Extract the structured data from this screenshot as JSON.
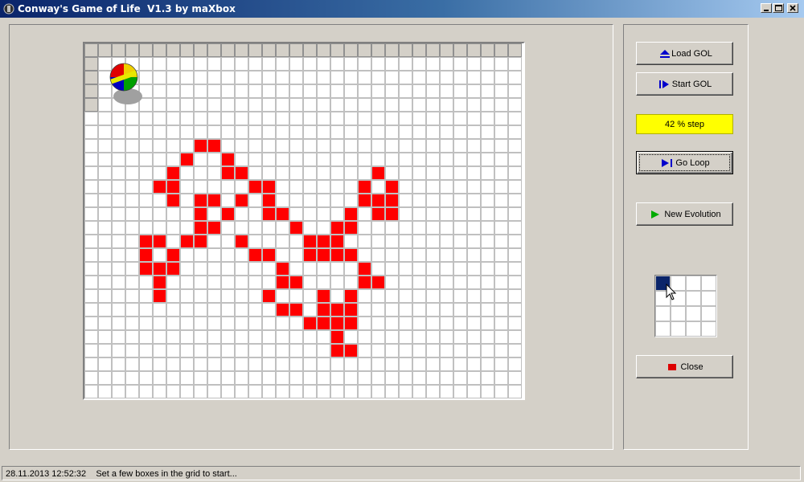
{
  "window": {
    "title": "Conway's Game of Life  V1.3 by maXbox",
    "controls": [
      "minimize",
      "maximize",
      "close"
    ]
  },
  "buttons": {
    "load": {
      "label": "Load GOL",
      "icon": "eject-icon",
      "icon_color": "#0000cc"
    },
    "start": {
      "label": "Start GOL",
      "icon": "play-bar-icon",
      "icon_color": "#0000cc"
    },
    "loop": {
      "label": "Go Loop",
      "icon": "play-bar-icon",
      "icon_color": "#0000cc"
    },
    "new_evolution": {
      "label": "New Evolution",
      "icon": "play-icon",
      "icon_color": "#00aa00"
    },
    "close": {
      "label": "Close",
      "icon": "stop-square-icon",
      "icon_color": "#dd0000"
    }
  },
  "progress": {
    "text": "42 % step",
    "background": "#ffff00"
  },
  "grid": {
    "cols": 32,
    "rows": 26,
    "alive_color": "#ff0000",
    "line_color": "#c0c0c0",
    "alive": [
      [
        8,
        7
      ],
      [
        9,
        7
      ],
      [
        7,
        8
      ],
      [
        10,
        8
      ],
      [
        6,
        9
      ],
      [
        10,
        9
      ],
      [
        11,
        9
      ],
      [
        5,
        10
      ],
      [
        6,
        10
      ],
      [
        12,
        10
      ],
      [
        13,
        10
      ],
      [
        6,
        11
      ],
      [
        8,
        11
      ],
      [
        9,
        11
      ],
      [
        11,
        11
      ],
      [
        13,
        11
      ],
      [
        8,
        12
      ],
      [
        10,
        12
      ],
      [
        13,
        12
      ],
      [
        14,
        12
      ],
      [
        8,
        13
      ],
      [
        9,
        13
      ],
      [
        15,
        13
      ],
      [
        4,
        14
      ],
      [
        5,
        14
      ],
      [
        7,
        14
      ],
      [
        8,
        14
      ],
      [
        11,
        14
      ],
      [
        4,
        15
      ],
      [
        6,
        15
      ],
      [
        12,
        15
      ],
      [
        13,
        15
      ],
      [
        4,
        16
      ],
      [
        5,
        16
      ],
      [
        6,
        16
      ],
      [
        14,
        16
      ],
      [
        5,
        17
      ],
      [
        14,
        17
      ],
      [
        15,
        17
      ],
      [
        5,
        18
      ],
      [
        13,
        18
      ],
      [
        14,
        19
      ],
      [
        15,
        19
      ],
      [
        16,
        20
      ],
      [
        17,
        20
      ],
      [
        21,
        9
      ],
      [
        20,
        10
      ],
      [
        22,
        10
      ],
      [
        20,
        11
      ],
      [
        21,
        11
      ],
      [
        22,
        11
      ],
      [
        19,
        12
      ],
      [
        21,
        12
      ],
      [
        22,
        12
      ],
      [
        18,
        13
      ],
      [
        19,
        13
      ],
      [
        16,
        14
      ],
      [
        17,
        14
      ],
      [
        18,
        14
      ],
      [
        16,
        15
      ],
      [
        17,
        15
      ],
      [
        18,
        15
      ],
      [
        19,
        15
      ],
      [
        20,
        16
      ],
      [
        20,
        17
      ],
      [
        21,
        17
      ],
      [
        17,
        18
      ],
      [
        19,
        18
      ],
      [
        17,
        19
      ],
      [
        18,
        19
      ],
      [
        19,
        19
      ],
      [
        18,
        20
      ],
      [
        19,
        20
      ],
      [
        18,
        21
      ],
      [
        18,
        22
      ],
      [
        19,
        22
      ]
    ]
  },
  "mini_grid": {
    "cols": 4,
    "rows": 4,
    "selected_color": "#0a246a",
    "selected_cell": [
      0,
      0
    ]
  },
  "statusbar": {
    "text": "28.11.2013 12:52:32    Set a few boxes in the grid to start..."
  }
}
